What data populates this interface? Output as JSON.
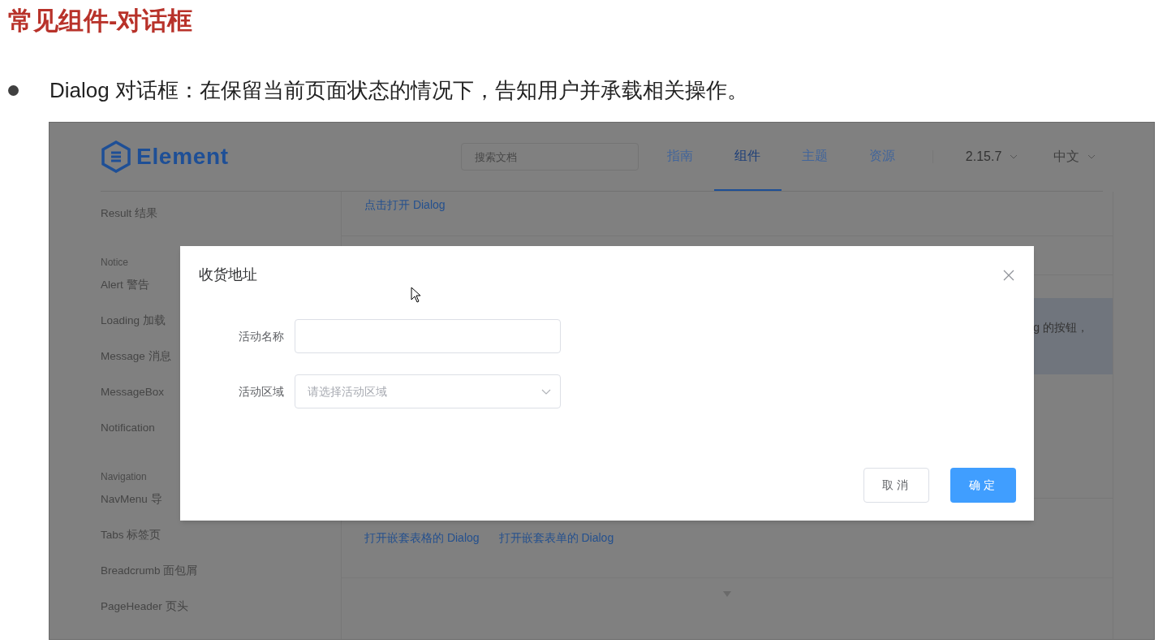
{
  "slide": {
    "title": "常见组件-对话框",
    "bullet": "Dialog 对话框：在保留当前页面状态的情况下，告知用户并承载相关操作。"
  },
  "site": {
    "logo": "Element",
    "search": {
      "placeholder": "搜索文档"
    },
    "nav": [
      {
        "label": "指南",
        "selected": false
      },
      {
        "label": "组件",
        "selected": true
      },
      {
        "label": "主题",
        "selected": false
      },
      {
        "label": "资源",
        "selected": false
      }
    ],
    "version": "2.15.7",
    "language": "中文"
  },
  "sidebar": {
    "items": [
      {
        "kind": "item",
        "label": "Result 结果"
      },
      {
        "kind": "group",
        "label": "Notice"
      },
      {
        "kind": "item",
        "label": "Alert 警告"
      },
      {
        "kind": "item",
        "label": "Loading 加载"
      },
      {
        "kind": "item",
        "label": "Message 消息"
      },
      {
        "kind": "item",
        "label": "MessageBox"
      },
      {
        "kind": "item",
        "label": "Notification"
      },
      {
        "kind": "group",
        "label": "Navigation"
      },
      {
        "kind": "item",
        "label": "NavMenu 导"
      },
      {
        "kind": "item",
        "label": "Tabs 标签页"
      },
      {
        "kind": "item",
        "label": "Breadcrumb 面包屑"
      },
      {
        "kind": "item",
        "label": "PageHeader 页头"
      }
    ]
  },
  "content": {
    "demo_link": "点击打开 Dialog",
    "alert_text": "g 的按钮，",
    "nested_links": [
      "打开嵌套表格的 Dialog",
      "打开嵌套表单的 Dialog"
    ]
  },
  "dialog": {
    "title": "收货地址",
    "fields": [
      {
        "kind": "input",
        "label": "活动名称"
      },
      {
        "kind": "select",
        "label": "活动区域",
        "placeholder": "请选择活动区域"
      }
    ],
    "buttons": [
      {
        "label": "取消",
        "primary": false
      },
      {
        "label": "确定",
        "primary": true
      }
    ]
  }
}
